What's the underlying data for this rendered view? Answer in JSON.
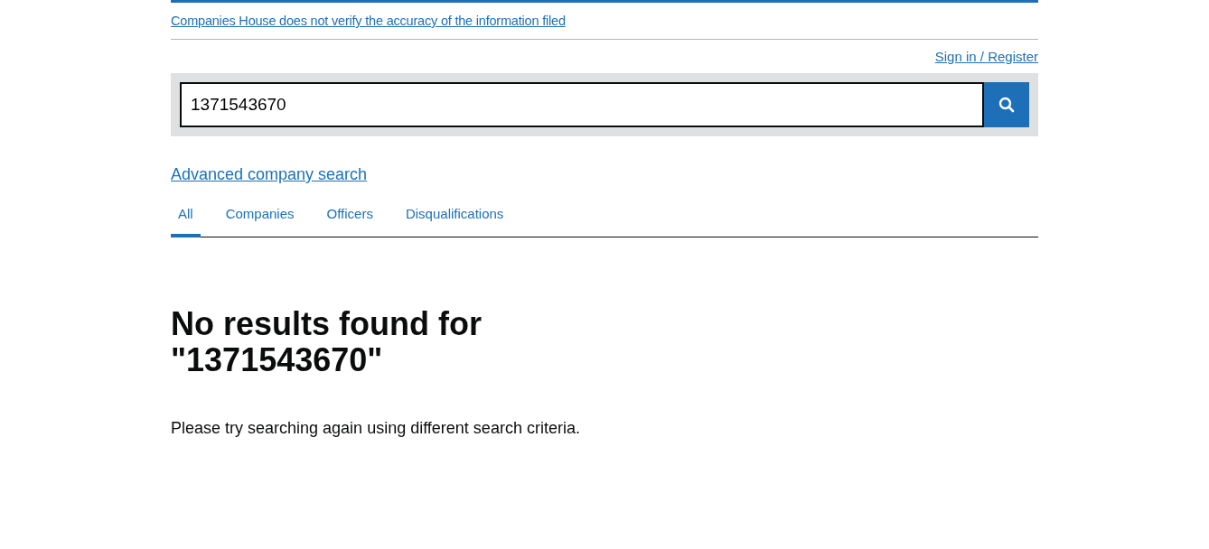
{
  "notice_link": "Companies House does not verify the accuracy of the information filed",
  "account_link": "Sign in / Register",
  "search": {
    "value": "1371543670"
  },
  "advanced_link": "Advanced company search",
  "tabs": [
    {
      "label": "All",
      "selected": true
    },
    {
      "label": "Companies",
      "selected": false
    },
    {
      "label": "Officers",
      "selected": false
    },
    {
      "label": "Disqualifications",
      "selected": false
    }
  ],
  "heading": "No results found for \"1371543670\"",
  "message": "Please try searching again using different search criteria."
}
